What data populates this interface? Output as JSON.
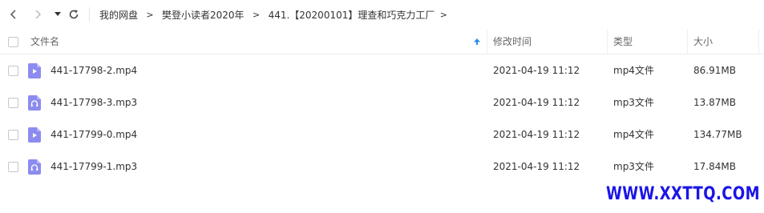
{
  "breadcrumb": {
    "items": [
      "我的网盘",
      "樊登小读者2020年",
      "441.【20200101】理查和巧克力工厂"
    ],
    "separator": ">"
  },
  "table": {
    "columns": {
      "name": "文件名",
      "modified": "修改时间",
      "type": "类型",
      "size": "大小"
    },
    "sort": {
      "column": "name",
      "direction": "ascending"
    },
    "rows": [
      {
        "name": "441-17798-2.mp4",
        "modified": "2021-04-19 11:12",
        "type": "mp4文件",
        "size": "86.91MB",
        "icon": "video-file-icon"
      },
      {
        "name": "441-17798-3.mp3",
        "modified": "2021-04-19 11:12",
        "type": "mp3文件",
        "size": "13.87MB",
        "icon": "audio-file-icon"
      },
      {
        "name": "441-17799-0.mp4",
        "modified": "2021-04-19 11:12",
        "type": "mp4文件",
        "size": "134.77MB",
        "icon": "video-file-icon"
      },
      {
        "name": "441-17799-1.mp3",
        "modified": "2021-04-19 11:12",
        "type": "mp3文件",
        "size": "17.84MB",
        "icon": "audio-file-icon"
      }
    ]
  },
  "watermark": "WWW.XXTTQ.COM",
  "colors": {
    "file_icon": "#8b8bf0",
    "sort_arrow": "#2b8ce8",
    "watermark": "#1a14e6"
  }
}
